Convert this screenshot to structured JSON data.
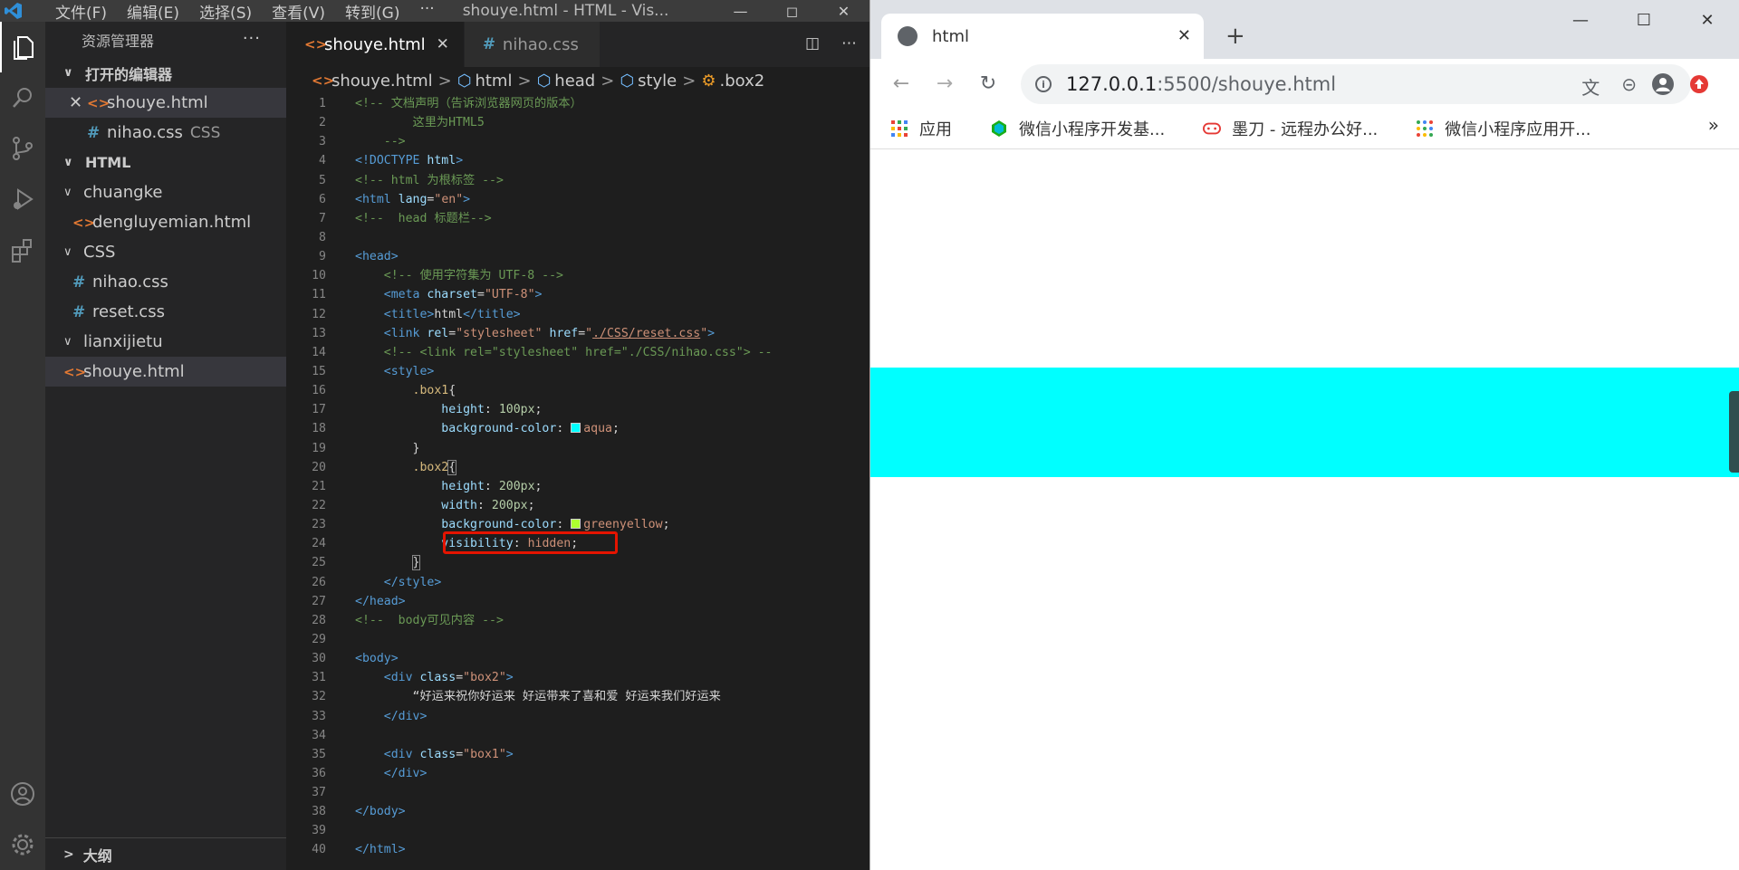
{
  "vscode": {
    "menu": [
      "文件(F)",
      "编辑(E)",
      "选择(S)",
      "查看(V)",
      "转到(G)",
      "···"
    ],
    "window_title": "shouye.html - HTML - Vis...",
    "explorer_title": "资源管理器",
    "explorer_more": "···",
    "open_editors_title": "打开的编辑器",
    "open_editors": [
      {
        "name": "shouye.html",
        "desc": ""
      },
      {
        "name": "nihao.css",
        "desc": "CSS"
      }
    ],
    "workspace_title": "HTML",
    "tree": {
      "chuangke": "chuangke",
      "dengluyemian": "dengluyemian.html",
      "css_folder": "CSS",
      "nihao": "nihao.css",
      "reset": "reset.css",
      "lianxijietu": "lianxijietu",
      "shouye": "shouye.html"
    },
    "outline_title": "大纲",
    "tabs": [
      {
        "label": "shouye.html",
        "active": true
      },
      {
        "label": "nihao.css",
        "active": false
      }
    ],
    "breadcrumb": [
      "shouye.html",
      "html",
      "head",
      "style",
      ".box2"
    ],
    "colors": {
      "aqua": "#00ffff",
      "greenyellow": "#adff2f",
      "highlight_box": "#e51400"
    }
  },
  "chrome": {
    "tab_title": "html",
    "url_host": "127.0.0.1",
    "url_path": ":5500/shouye.html",
    "bookmarks": [
      "应用",
      "微信小程序开发基...",
      "墨刀 - 远程办公好...",
      "微信小程序应用开..."
    ],
    "bookmarks_more": "»"
  }
}
